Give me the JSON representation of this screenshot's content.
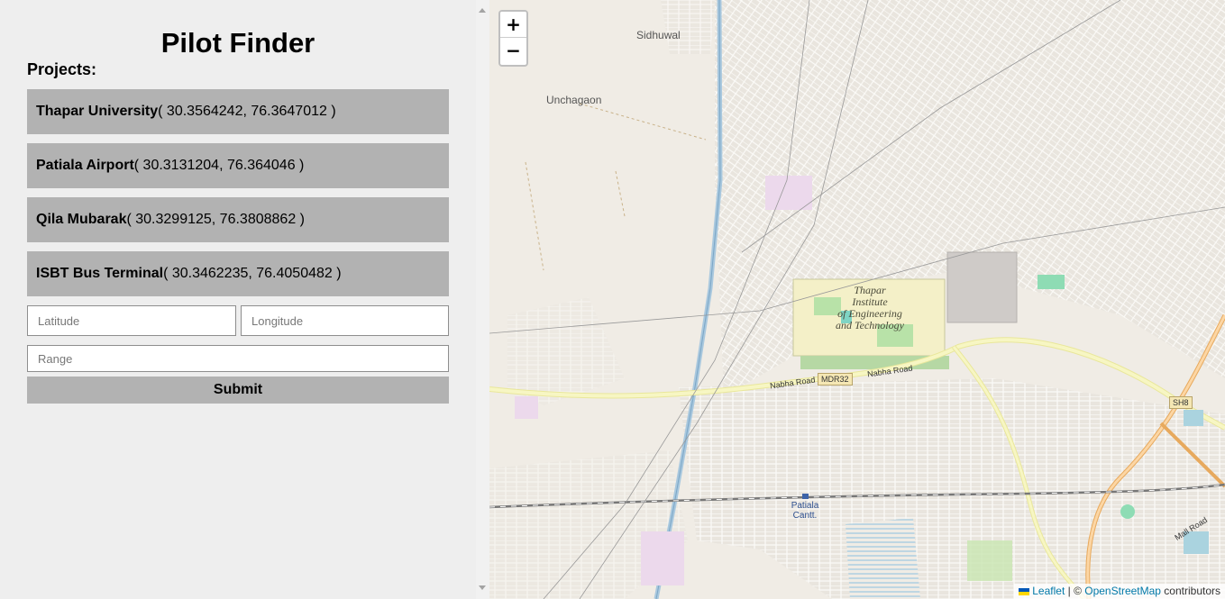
{
  "title": "Pilot Finder",
  "projects_heading": "Projects:",
  "projects": [
    {
      "name": "Thapar University",
      "coords": "( 30.3564242, 76.3647012 )"
    },
    {
      "name": "Patiala Airport",
      "coords": "( 30.3131204, 76.364046 )"
    },
    {
      "name": "Qila Mubarak",
      "coords": "( 30.3299125, 76.3808862 )"
    },
    {
      "name": "ISBT Bus Terminal",
      "coords": "( 30.3462235, 76.4050482 )"
    }
  ],
  "form": {
    "latitude_placeholder": "Latitude",
    "longitude_placeholder": "Longitude",
    "range_placeholder": "Range",
    "submit_label": "Submit"
  },
  "map": {
    "zoom_in_label": "+",
    "zoom_out_label": "−",
    "labels": {
      "sidhuwal": "Sidhuwal",
      "unchagaon": "Unchagaon",
      "thapar": [
        "Thapar",
        "Institute",
        "of Engineering",
        "and Technology"
      ],
      "nabha_road_1": "Nabha Road",
      "nabha_road_2": "Nabha Road",
      "mdr32": "MDR32",
      "sh8": "SH8",
      "patiala_cantt": [
        "Patiala",
        "Cantt."
      ],
      "mall_road": "Mall Road"
    },
    "attribution": {
      "leaflet": "Leaflet",
      "separator": " | © ",
      "osm": "OpenStreetMap",
      "suffix": " contributors"
    }
  }
}
